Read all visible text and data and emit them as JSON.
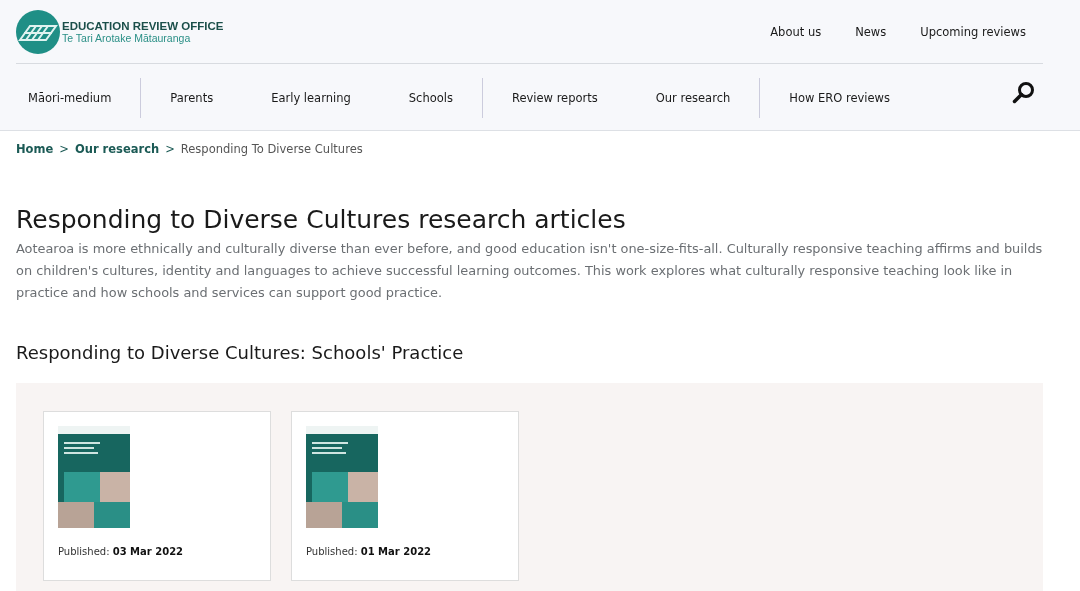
{
  "header": {
    "logo": {
      "title": "EDUCATION REVIEW OFFICE",
      "subtitle": "Te Tari Arotake Mātauranga"
    },
    "top_links": [
      "About us",
      "News",
      "Upcoming reviews"
    ],
    "nav_groups": [
      [
        "Māori-medium"
      ],
      [
        "Parents",
        "Early learning",
        "Schools"
      ],
      [
        "Review reports",
        "Our research"
      ],
      [
        "How ERO reviews"
      ]
    ]
  },
  "breadcrumb": {
    "separator": ">",
    "items": [
      {
        "label": "Home",
        "kind": "link"
      },
      {
        "label": "Our research",
        "kind": "link"
      },
      {
        "label": "Responding To Diverse Cultures",
        "kind": "current"
      }
    ]
  },
  "title": "Responding to Diverse Cultures research articles",
  "intro": "Aotearoa is more ethnically and culturally diverse than ever before, and good education isn't one-size-fits-all. Culturally responsive teaching affirms and builds on children's cultures, identity and languages to achieve successful learning outcomes. This work explores what culturally responsive teaching look like in practice and how schools and services can support good practice.",
  "section": {
    "heading": "Responding to Diverse Cultures: Schools' Practice",
    "cards": [
      {
        "published_label": "Published:",
        "date": "03 Mar 2022"
      },
      {
        "published_label": "Published:",
        "date": "01 Mar 2022"
      }
    ]
  }
}
